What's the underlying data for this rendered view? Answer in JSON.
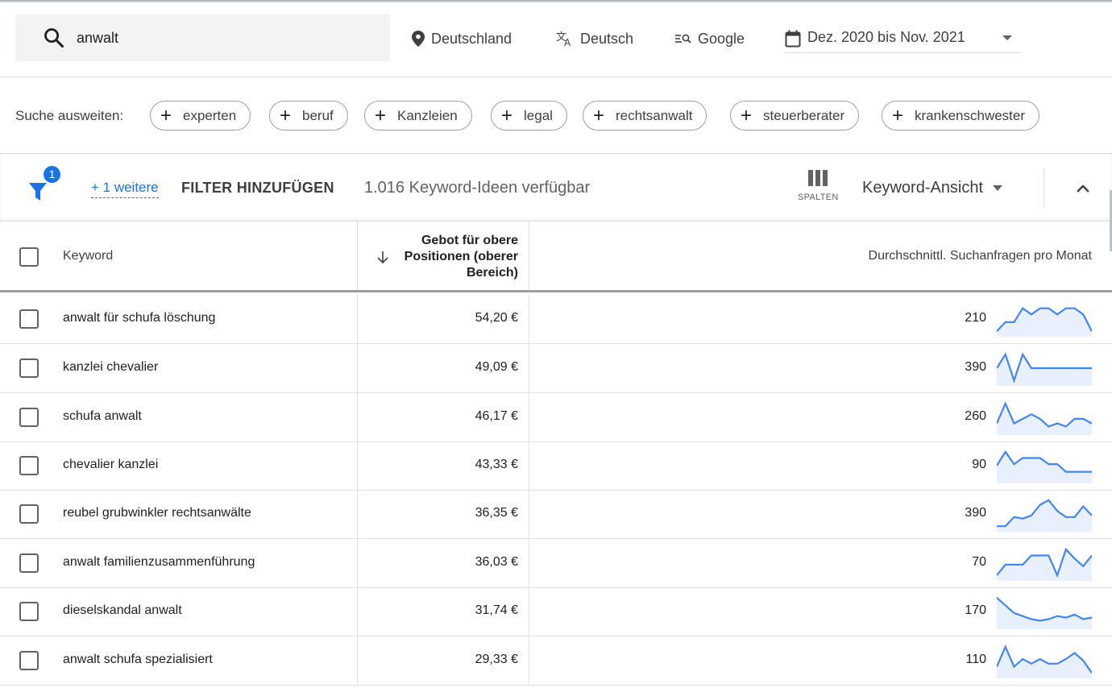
{
  "search": {
    "query": "anwalt"
  },
  "filters": {
    "location": "Deutschland",
    "language": "Deutsch",
    "network": "Google",
    "date_range": "Dez. 2020 bis Nov. 2021"
  },
  "expand": {
    "label": "Suche ausweiten:",
    "chips": [
      "experten",
      "beruf",
      "Kanzleien",
      "legal",
      "rechtsanwalt",
      "steuerberater",
      "krankenschwester"
    ]
  },
  "filterbar": {
    "badge": "1",
    "more_filters": "+ 1 weitere",
    "add_filter": "FILTER HINZUFÜGEN",
    "ideas_count": "1.016 Keyword-Ideen verfügbar",
    "columns_label": "SPALTEN",
    "view_label": "Keyword-Ansicht"
  },
  "table": {
    "headers": {
      "keyword": "Keyword",
      "bid": "Gebot für obere Positionen (oberer Bereich)",
      "avg": "Durchschnittl. Suchanfragen pro Monat"
    },
    "rows": [
      {
        "keyword": "anwalt für schufa löschung",
        "bid": "54,20 €",
        "avg": "210",
        "trend": [
          0.1,
          0.4,
          0.4,
          0.85,
          0.65,
          0.85,
          0.85,
          0.65,
          0.85,
          0.85,
          0.65,
          0.1
        ]
      },
      {
        "keyword": "kanzlei chevalier",
        "bid": "49,09 €",
        "avg": "390",
        "trend": [
          0.5,
          0.95,
          0.1,
          0.95,
          0.5,
          0.5,
          0.5,
          0.5,
          0.5,
          0.5,
          0.5,
          0.5
        ]
      },
      {
        "keyword": "schufa anwalt",
        "bid": "46,17 €",
        "avg": "260",
        "trend": [
          0.3,
          0.95,
          0.3,
          0.45,
          0.6,
          0.45,
          0.2,
          0.3,
          0.2,
          0.45,
          0.45,
          0.3
        ]
      },
      {
        "keyword": "chevalier kanzlei",
        "bid": "43,33 €",
        "avg": "90",
        "trend": [
          0.5,
          0.95,
          0.55,
          0.75,
          0.75,
          0.75,
          0.55,
          0.55,
          0.3,
          0.3,
          0.3,
          0.3
        ]
      },
      {
        "keyword": "reubel grubwinkler rechtsanwälte",
        "bid": "36,35 €",
        "avg": "390",
        "trend": [
          0.1,
          0.1,
          0.4,
          0.35,
          0.45,
          0.8,
          0.95,
          0.6,
          0.4,
          0.4,
          0.75,
          0.45
        ]
      },
      {
        "keyword": "anwalt familienzusammenführung",
        "bid": "36,03 €",
        "avg": "70",
        "trend": [
          0.1,
          0.45,
          0.45,
          0.45,
          0.75,
          0.75,
          0.75,
          0.1,
          0.95,
          0.65,
          0.4,
          0.75
        ]
      },
      {
        "keyword": "dieselskandal anwalt",
        "bid": "31,74 €",
        "avg": "170",
        "trend": [
          0.95,
          0.7,
          0.45,
          0.35,
          0.25,
          0.2,
          0.25,
          0.35,
          0.3,
          0.4,
          0.25,
          0.3
        ]
      },
      {
        "keyword": "anwalt schufa spezialisiert",
        "bid": "29,33 €",
        "avg": "110",
        "trend": [
          0.3,
          0.95,
          0.3,
          0.55,
          0.4,
          0.55,
          0.4,
          0.4,
          0.55,
          0.75,
          0.5,
          0.1
        ]
      }
    ]
  },
  "colors": {
    "accent": "#1a73e8",
    "spark_fill": "#e8f0fe",
    "spark_line": "#4285f4"
  }
}
